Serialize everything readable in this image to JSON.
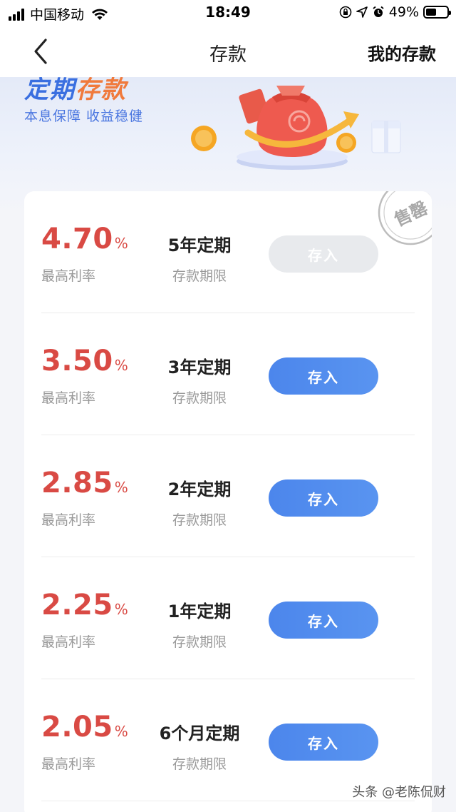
{
  "status_bar": {
    "carrier": "中国移动",
    "time": "18:49",
    "battery": "49%",
    "battery_level": 0.49
  },
  "nav": {
    "title": "存款",
    "right_link": "我的存款"
  },
  "banner": {
    "title_part1": "定期",
    "title_part2": "存款",
    "subtitle": "本息保障 收益稳健"
  },
  "sold_out_stamp": "售罄",
  "products": [
    {
      "rate": "4.70",
      "pct": "%",
      "rate_label": "最高利率",
      "term": "5年定期",
      "term_label": "存款期限",
      "button": "存入",
      "sold_out": true
    },
    {
      "rate": "3.50",
      "pct": "%",
      "rate_label": "最高利率",
      "term": "3年定期",
      "term_label": "存款期限",
      "button": "存入",
      "sold_out": false
    },
    {
      "rate": "2.85",
      "pct": "%",
      "rate_label": "最高利率",
      "term": "2年定期",
      "term_label": "存款期限",
      "button": "存入",
      "sold_out": false
    },
    {
      "rate": "2.25",
      "pct": "%",
      "rate_label": "最高利率",
      "term": "1年定期",
      "term_label": "存款期限",
      "button": "存入",
      "sold_out": false
    },
    {
      "rate": "2.05",
      "pct": "%",
      "rate_label": "最高利率",
      "term": "6个月定期",
      "term_label": "存款期限",
      "button": "存入",
      "sold_out": false
    }
  ],
  "watermark": "头条 @老陈侃财",
  "colors": {
    "rate": "#d94a44",
    "button": "#4c86ec",
    "button_disabled": "#e8eaed",
    "banner_blue": "#3a6fe0"
  }
}
